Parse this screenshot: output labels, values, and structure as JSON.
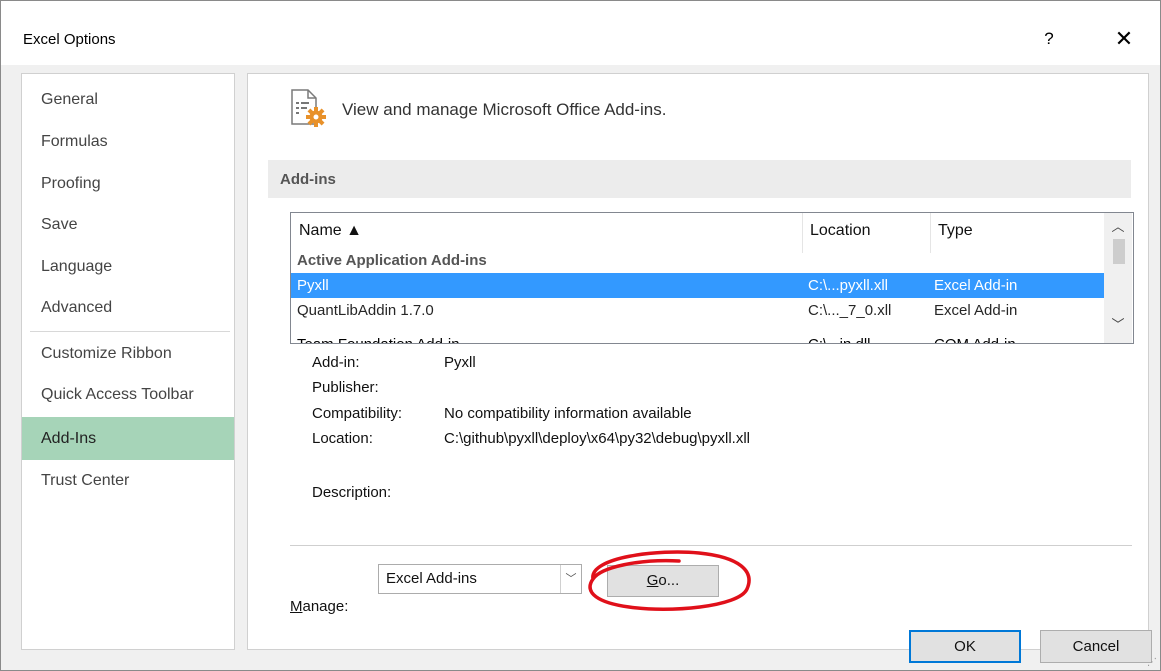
{
  "window": {
    "title": "Excel Options",
    "help_label": "?",
    "close_label": "✕"
  },
  "sidebar": {
    "items": [
      {
        "label": "General"
      },
      {
        "label": "Formulas"
      },
      {
        "label": "Proofing"
      },
      {
        "label": "Save"
      },
      {
        "label": "Language"
      },
      {
        "label": "Advanced"
      },
      {
        "label": "Customize Ribbon"
      },
      {
        "label": "Quick Access Toolbar"
      },
      {
        "label": "Add-Ins",
        "selected": true
      },
      {
        "label": "Trust Center"
      }
    ]
  },
  "main": {
    "header_icon": "addins-gear-icon",
    "header_text": "View and manage Microsoft Office Add-ins.",
    "section_title": "Add-ins",
    "list": {
      "columns": [
        "Name ▲",
        "Location",
        "Type"
      ],
      "group_label": "Active Application Add-ins",
      "rows": [
        {
          "name": "Pyxll",
          "location": "C:\\...pyxll.xll",
          "type": "Excel Add-in",
          "selected": true
        },
        {
          "name": "QuantLibAddin 1.7.0",
          "location": "C:\\..._7_0.xll",
          "type": "Excel Add-in"
        },
        {
          "name": "Team Foundation Add-in",
          "location": "C:\\...in.dll",
          "type": "COM Add-in"
        }
      ]
    },
    "details": {
      "addin_label": "Add-in:",
      "addin_value": "Pyxll",
      "publisher_label": "Publisher:",
      "publisher_value": "",
      "compat_label": "Compatibility:",
      "compat_value": "No compatibility information available",
      "location_label": "Location:",
      "location_value": "C:\\github\\pyxll\\deploy\\x64\\py32\\debug\\pyxll.xll",
      "description_label": "Description:",
      "description_value": ""
    },
    "manage": {
      "label_prefix": "M",
      "label_rest": "anage:",
      "selected": "Excel Add-ins",
      "go_prefix": "G",
      "go_rest": "o..."
    }
  },
  "footer": {
    "ok_label": "OK",
    "cancel_label": "Cancel"
  },
  "colors": {
    "selected_nav": "#a6d4b8",
    "selected_row": "#3399ff",
    "annotation": "#e0101a"
  }
}
